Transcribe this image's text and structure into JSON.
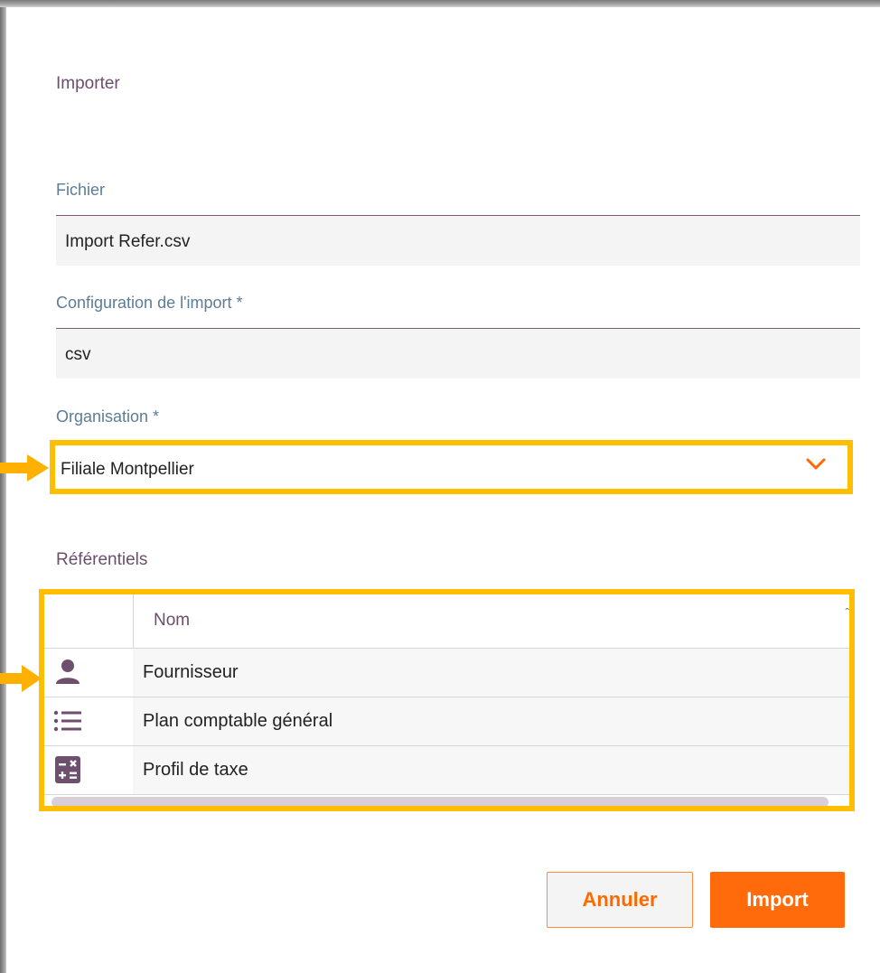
{
  "dialog": {
    "title": "Importer",
    "fields": {
      "file": {
        "label": "Fichier",
        "value": "Import Refer.csv"
      },
      "config": {
        "label": "Configuration de l'import *",
        "value": "csv"
      },
      "organisation": {
        "label": "Organisation *",
        "value": "Filiale Montpellier"
      }
    },
    "referentiels": {
      "label": "Référentiels",
      "column_header": "Nom",
      "rows": [
        {
          "icon": "person-icon",
          "name": "Fournisseur"
        },
        {
          "icon": "list-icon",
          "name": "Plan comptable général"
        },
        {
          "icon": "calculator-icon",
          "name": "Profil de taxe"
        }
      ]
    },
    "buttons": {
      "cancel": "Annuler",
      "import": "Import"
    }
  },
  "colors": {
    "accent": "#ff6a0a",
    "highlight": "#ffbf00",
    "label_blue": "#5b7d95",
    "label_purple": "#6b4f6b",
    "icon_purple": "#6e4f6e"
  }
}
